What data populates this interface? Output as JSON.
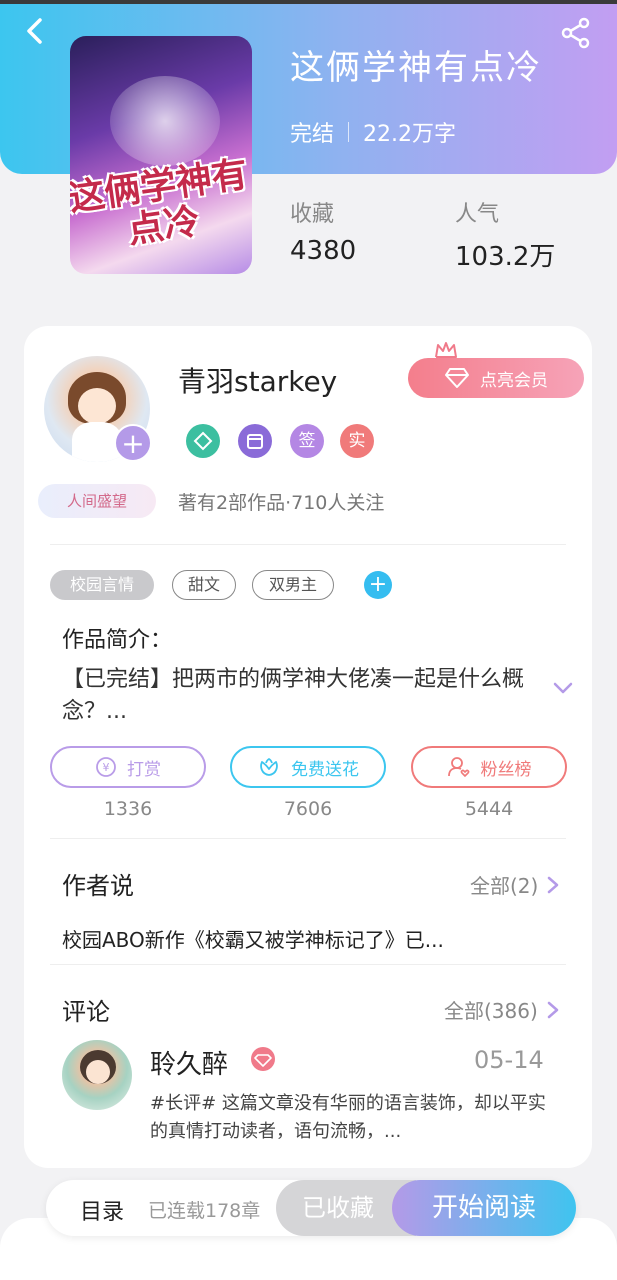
{
  "book": {
    "title": "这俩学神有点冷",
    "status": "完结",
    "word_count": "22.2万字",
    "cover_title": "这俩学神有点冷",
    "stats": [
      {
        "label": "收藏",
        "value": "4380"
      },
      {
        "label": "人气",
        "value": "103.2万"
      }
    ]
  },
  "author": {
    "name": "青羽starkey",
    "badge": "人间盛望",
    "stats_text": "著有2部作品·710人关注",
    "vip_button": "点亮会员",
    "medals": [
      {
        "icon": "handshake-medal-icon",
        "color": "#3cbfa0"
      },
      {
        "icon": "calendar-medal-icon",
        "color": "#8a6bd8"
      },
      {
        "icon": "sign-medal-icon",
        "label": "签",
        "color": "#b487e4"
      },
      {
        "icon": "verified-medal-icon",
        "label": "实",
        "color": "#f07a7a"
      }
    ]
  },
  "tags": [
    "校园言情",
    "甜文",
    "双男主"
  ],
  "intro": {
    "title": "作品简介：",
    "text": "【已完结】把两市的俩学神大佬凑一起是什么概念？..."
  },
  "actions": [
    {
      "label": "打赏",
      "count": "1336",
      "icon": "coin-icon",
      "color": "#b99ce8"
    },
    {
      "label": "免费送花",
      "count": "7606",
      "icon": "flower-icon",
      "color": "#3cc6ef"
    },
    {
      "label": "粉丝榜",
      "count": "5444",
      "icon": "fan-user-icon",
      "color": "#f07a7a"
    }
  ],
  "author_says": {
    "title": "作者说",
    "more": "全部(2)",
    "text": "校园ABO新作《校霸又被学神标记了》已..."
  },
  "comments": {
    "title": "评论",
    "more": "全部(386)",
    "items": [
      {
        "name": "聆久醉",
        "date": "05-14",
        "text": "#长评# 这篇文章没有华丽的语言装饰，却以平实的真情打动读者，语句流畅，..."
      }
    ]
  },
  "bottom_bar": {
    "toc": "目录",
    "toc_status": "已连载178章",
    "collected": "已收藏",
    "read": "开始阅读"
  }
}
